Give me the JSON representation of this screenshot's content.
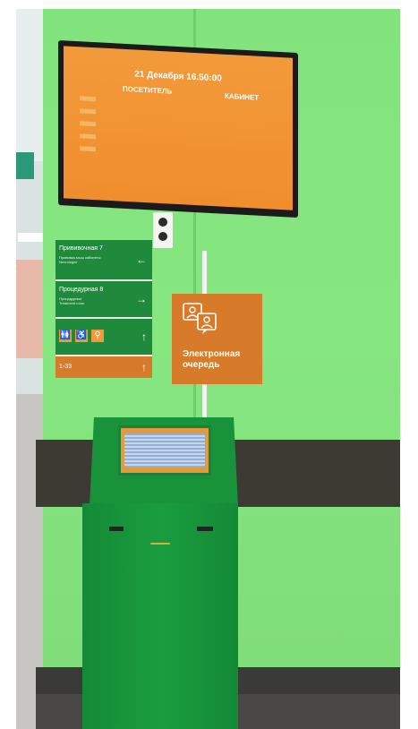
{
  "tv": {
    "date_time": "21 Декабря  16.50:00",
    "col_visitor": "ПОСЕТИТЕЛЬ",
    "col_room": "КАБИНЕТ"
  },
  "signs": [
    {
      "title": "Прививочная 7",
      "subtitle": "Прививка мыш кабинеты\nNeurologist",
      "arrow": "←"
    },
    {
      "title": "Процедурная 8",
      "subtitle": "Процедурные\nTreatment room",
      "arrow": "→"
    },
    {
      "title": "",
      "subtitle": "",
      "arrow": "↑",
      "icons": [
        "restroom-icon",
        "wheelchair-icon",
        "stroller-icon"
      ]
    },
    {
      "title": "1-33",
      "subtitle": "",
      "arrow": "↑"
    }
  ],
  "equeue": {
    "label_line1": "Электронная",
    "label_line2": "очередь",
    "icon": "queue-people-icon"
  },
  "colors": {
    "wall_green": "#86e680",
    "sign_green": "#1f8a3c",
    "sign_orange": "#d77a2a",
    "tv_screen": "#f08e2e",
    "kiosk_green": "#1a9d3f"
  }
}
